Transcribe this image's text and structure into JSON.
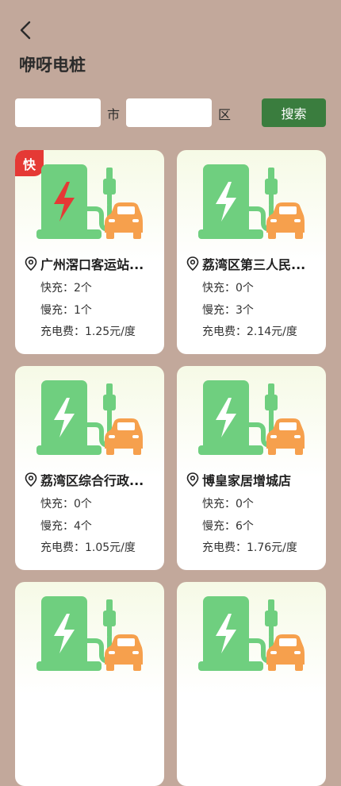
{
  "header": {
    "title": "咿呀电桩",
    "back_icon": "chevron-left-icon"
  },
  "search": {
    "city_value": "",
    "city_label": "市",
    "district_value": "",
    "district_label": "区",
    "button_label": "搜索"
  },
  "colors": {
    "background": "#c2a89b",
    "primary_green": "#3a7d3e",
    "icon_green": "#6fcf7f",
    "car_orange": "#f6a04d",
    "badge_red": "#e53935",
    "bolt_red": "#e53935"
  },
  "stations": [
    {
      "name": "广州滘口客运站...",
      "fast_badge": "快",
      "fast_label": "快充：2个",
      "slow_label": "慢充：1个",
      "fee_label": "充电费：1.25元/度"
    },
    {
      "name": "荔湾区第三人民...",
      "fast_badge": "",
      "fast_label": "快充：0个",
      "slow_label": "慢充：3个",
      "fee_label": "充电费：2.14元/度"
    },
    {
      "name": "荔湾区综合行政...",
      "fast_badge": "",
      "fast_label": "快充：0个",
      "slow_label": "慢充：4个",
      "fee_label": "充电费：1.05元/度"
    },
    {
      "name": "博皇家居增城店",
      "fast_badge": "",
      "fast_label": "快充：0个",
      "slow_label": "慢充：6个",
      "fee_label": "充电费：1.76元/度"
    },
    {
      "name": "",
      "fast_badge": "",
      "fast_label": "",
      "slow_label": "",
      "fee_label": ""
    },
    {
      "name": "",
      "fast_badge": "",
      "fast_label": "",
      "slow_label": "",
      "fee_label": ""
    }
  ]
}
